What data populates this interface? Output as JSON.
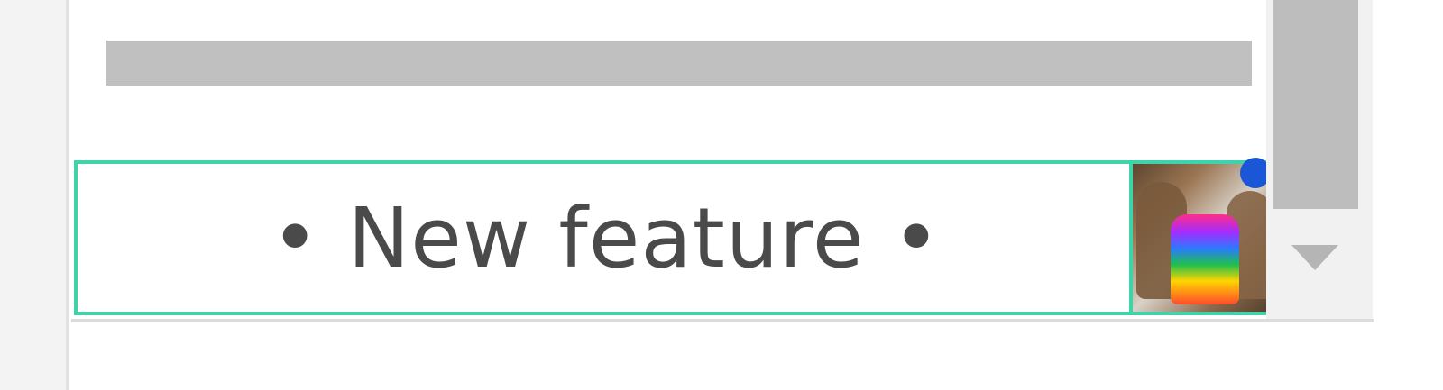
{
  "list": {
    "feature_item": {
      "label": "• New feature •",
      "thumbnail_icon": "pinata-thumbnail",
      "has_new_indicator": true
    }
  },
  "scrollbar": {
    "down_arrow_icon": "chevron-down-icon"
  },
  "colors": {
    "selection_border": "#3fd3a9",
    "new_indicator": "#1a56d6",
    "placeholder": "#c0c0c0"
  }
}
